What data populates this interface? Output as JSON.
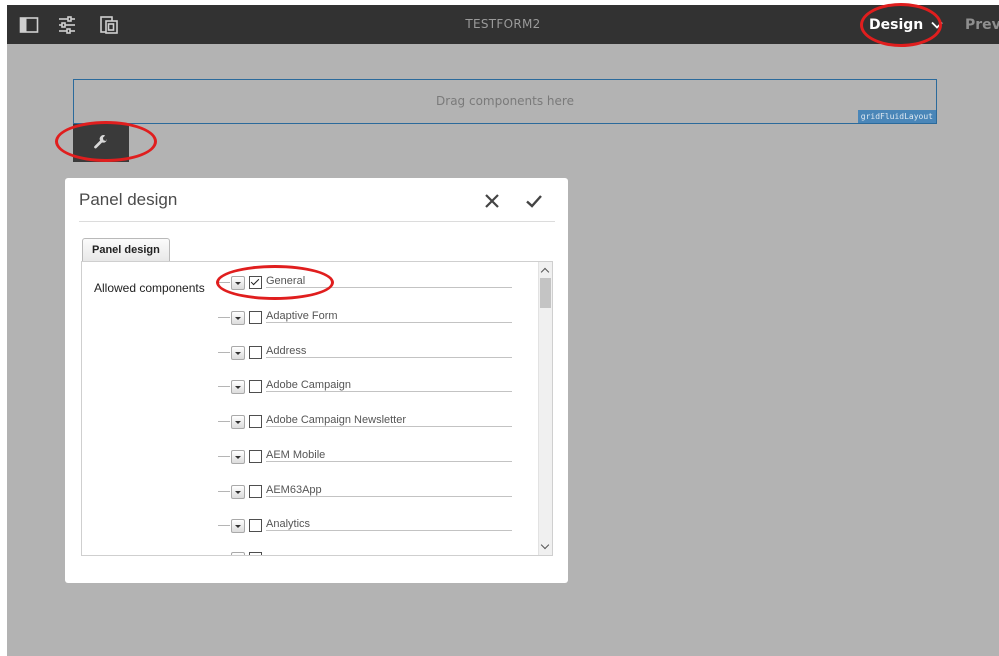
{
  "toolbar": {
    "title": "TESTFORM2",
    "mode_label": "Design",
    "preview_label": "Previ",
    "icons": [
      "side-panel-icon",
      "properties-sliders-icon",
      "emulator-icon",
      "chevron-down-icon"
    ]
  },
  "canvas": {
    "drop_text": "Drag components here",
    "grid_label": "gridFluidLayout",
    "wrench_icon": "wrench-icon"
  },
  "dialog": {
    "title": "Panel design",
    "tab_label": "Panel design",
    "field_label": "Allowed components",
    "components": [
      {
        "label": "General",
        "checked": true
      },
      {
        "label": "Adaptive Form",
        "checked": false
      },
      {
        "label": "Address",
        "checked": false
      },
      {
        "label": "Adobe Campaign",
        "checked": false
      },
      {
        "label": "Adobe Campaign Newsletter",
        "checked": false
      },
      {
        "label": "AEM Mobile",
        "checked": false
      },
      {
        "label": "AEM63App",
        "checked": false
      },
      {
        "label": "Analytics",
        "checked": false
      }
    ]
  },
  "colors": {
    "toolbar_bg": "#323232",
    "canvas_bg": "#b3b3b3",
    "highlight_ring": "#e01e1e",
    "layout_label_bg": "#4a86b8"
  }
}
